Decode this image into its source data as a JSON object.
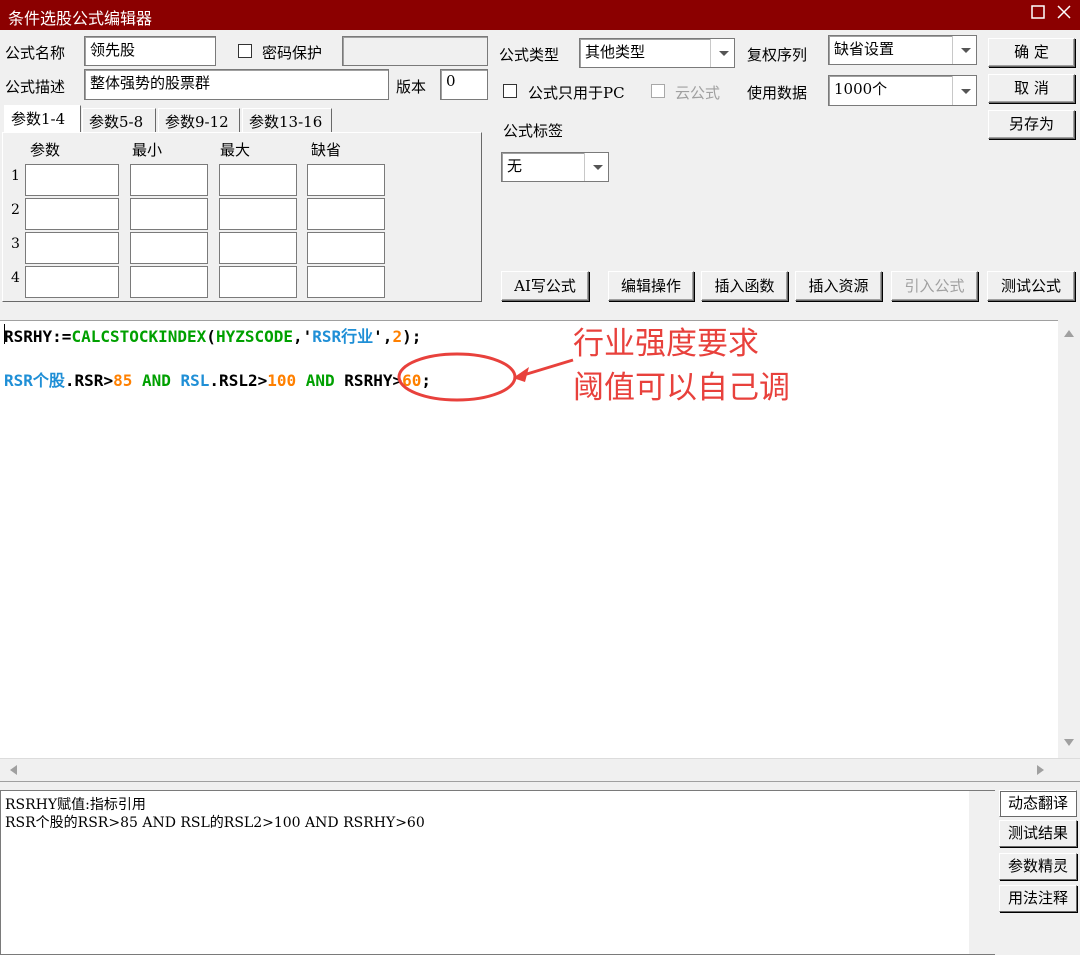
{
  "window": {
    "title": "条件选股公式编辑器"
  },
  "form": {
    "name_label": "公式名称",
    "name_value": "领先股",
    "password_label": "密码保护",
    "desc_label": "公式描述",
    "desc_value": "整体强势的股票群",
    "version_label": "版本",
    "version_value": "0",
    "type_label": "公式类型",
    "type_value": "其他类型",
    "rights_label": "复权序列",
    "rights_value": "缺省设置",
    "pc_only_label": "公式只用于PC",
    "cloud_label": "云公式",
    "data_label": "使用数据",
    "data_value": "1000个",
    "tag_label": "公式标签",
    "tag_value": "无"
  },
  "actions": {
    "ok": "确  定",
    "cancel": "取  消",
    "save_as": "另存为"
  },
  "tabs": [
    {
      "label": "参数1-4"
    },
    {
      "label": "参数5-8"
    },
    {
      "label": "参数9-12"
    },
    {
      "label": "参数13-16"
    }
  ],
  "params": {
    "headers": [
      "参数",
      "最小",
      "最大",
      "缺省"
    ],
    "rows": [
      "1",
      "2",
      "3",
      "4"
    ]
  },
  "toolbar": [
    {
      "label": "AI写公式"
    },
    {
      "label": "编辑操作"
    },
    {
      "label": "插入函数"
    },
    {
      "label": "插入资源"
    },
    {
      "label": "引入公式"
    },
    {
      "label": "测试公式"
    }
  ],
  "code": {
    "line1": [
      {
        "t": "RSRHY:=",
        "c": "#000000"
      },
      {
        "t": "CALCSTOCKINDEX",
        "c": "#00a000"
      },
      {
        "t": "(",
        "c": "#000000"
      },
      {
        "t": "HYZSCODE",
        "c": "#00a000"
      },
      {
        "t": ",'",
        "c": "#000000"
      },
      {
        "t": "RSR行业",
        "c": "#1f8fd6"
      },
      {
        "t": "',",
        "c": "#000000"
      },
      {
        "t": "2",
        "c": "#ff8000"
      },
      {
        "t": ");",
        "c": "#000000"
      }
    ],
    "line2": [
      {
        "t": "RSR个股",
        "c": "#1f8fd6"
      },
      {
        "t": ".RSR>",
        "c": "#000000"
      },
      {
        "t": "85",
        "c": "#ff8000"
      },
      {
        "t": " AND ",
        "c": "#00a000"
      },
      {
        "t": "RSL",
        "c": "#1f8fd6"
      },
      {
        "t": ".RSL2>",
        "c": "#000000"
      },
      {
        "t": "100",
        "c": "#ff8000"
      },
      {
        "t": " AND ",
        "c": "#00a000"
      },
      {
        "t": "RSRHY>",
        "c": "#000000"
      },
      {
        "t": "60",
        "c": "#ff8000"
      },
      {
        "t": ";",
        "c": "#000000"
      }
    ]
  },
  "annotation": {
    "line1": "行业强度要求",
    "line2": "阈值可以自己调",
    "color": "#e8413c"
  },
  "output": {
    "line1": "RSRHY赋值:指标引用",
    "line2": "RSR个股的RSR>85 AND RSL的RSL2>100 AND RSRHY>60"
  },
  "side_buttons": [
    {
      "label": "动态翻译"
    },
    {
      "label": "测试结果"
    },
    {
      "label": "参数精灵"
    },
    {
      "label": "用法注释"
    }
  ]
}
